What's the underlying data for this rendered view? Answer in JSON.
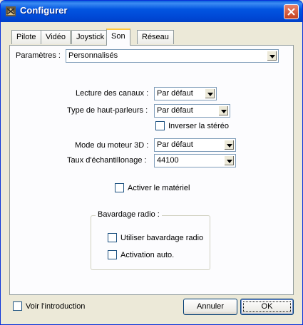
{
  "window": {
    "title": "Configurer",
    "close_icon": "close-icon",
    "app_icon": "app-icon"
  },
  "tabs": [
    {
      "label": "Pilote"
    },
    {
      "label": "Vidéo"
    },
    {
      "label": "Joystick"
    },
    {
      "label": "Son",
      "active": true
    },
    {
      "label": "Réseau"
    }
  ],
  "son": {
    "parametres_label": "Paramètres :",
    "parametres_value": "Personnalisés",
    "lecture_label": "Lecture des canaux :",
    "lecture_value": "Par défaut",
    "hautparleurs_label": "Type de haut-parleurs :",
    "hautparleurs_value": "Par défaut",
    "inverser_label": "Inverser la stéréo",
    "moteur3d_label": "Mode du moteur 3D :",
    "moteur3d_value": "Par défaut",
    "taux_label": "Taux d'échantillonage :",
    "taux_value": "44100",
    "materiel_label": "Activer le matériel",
    "bavardage_group": "Bavardage radio :",
    "bavardage_utiliser_label": "Utiliser bavardage radio",
    "activation_auto_label": "Activation auto."
  },
  "footer": {
    "intro_label": "Voir l'introduction",
    "cancel_label": "Annuler",
    "ok_label": "OK"
  },
  "colors": {
    "title_bar": "#0055E5",
    "dialog_bg": "#ECE9D8",
    "panel_bg": "#FCFCFE",
    "active_tab_accent": "#FFC83C"
  }
}
